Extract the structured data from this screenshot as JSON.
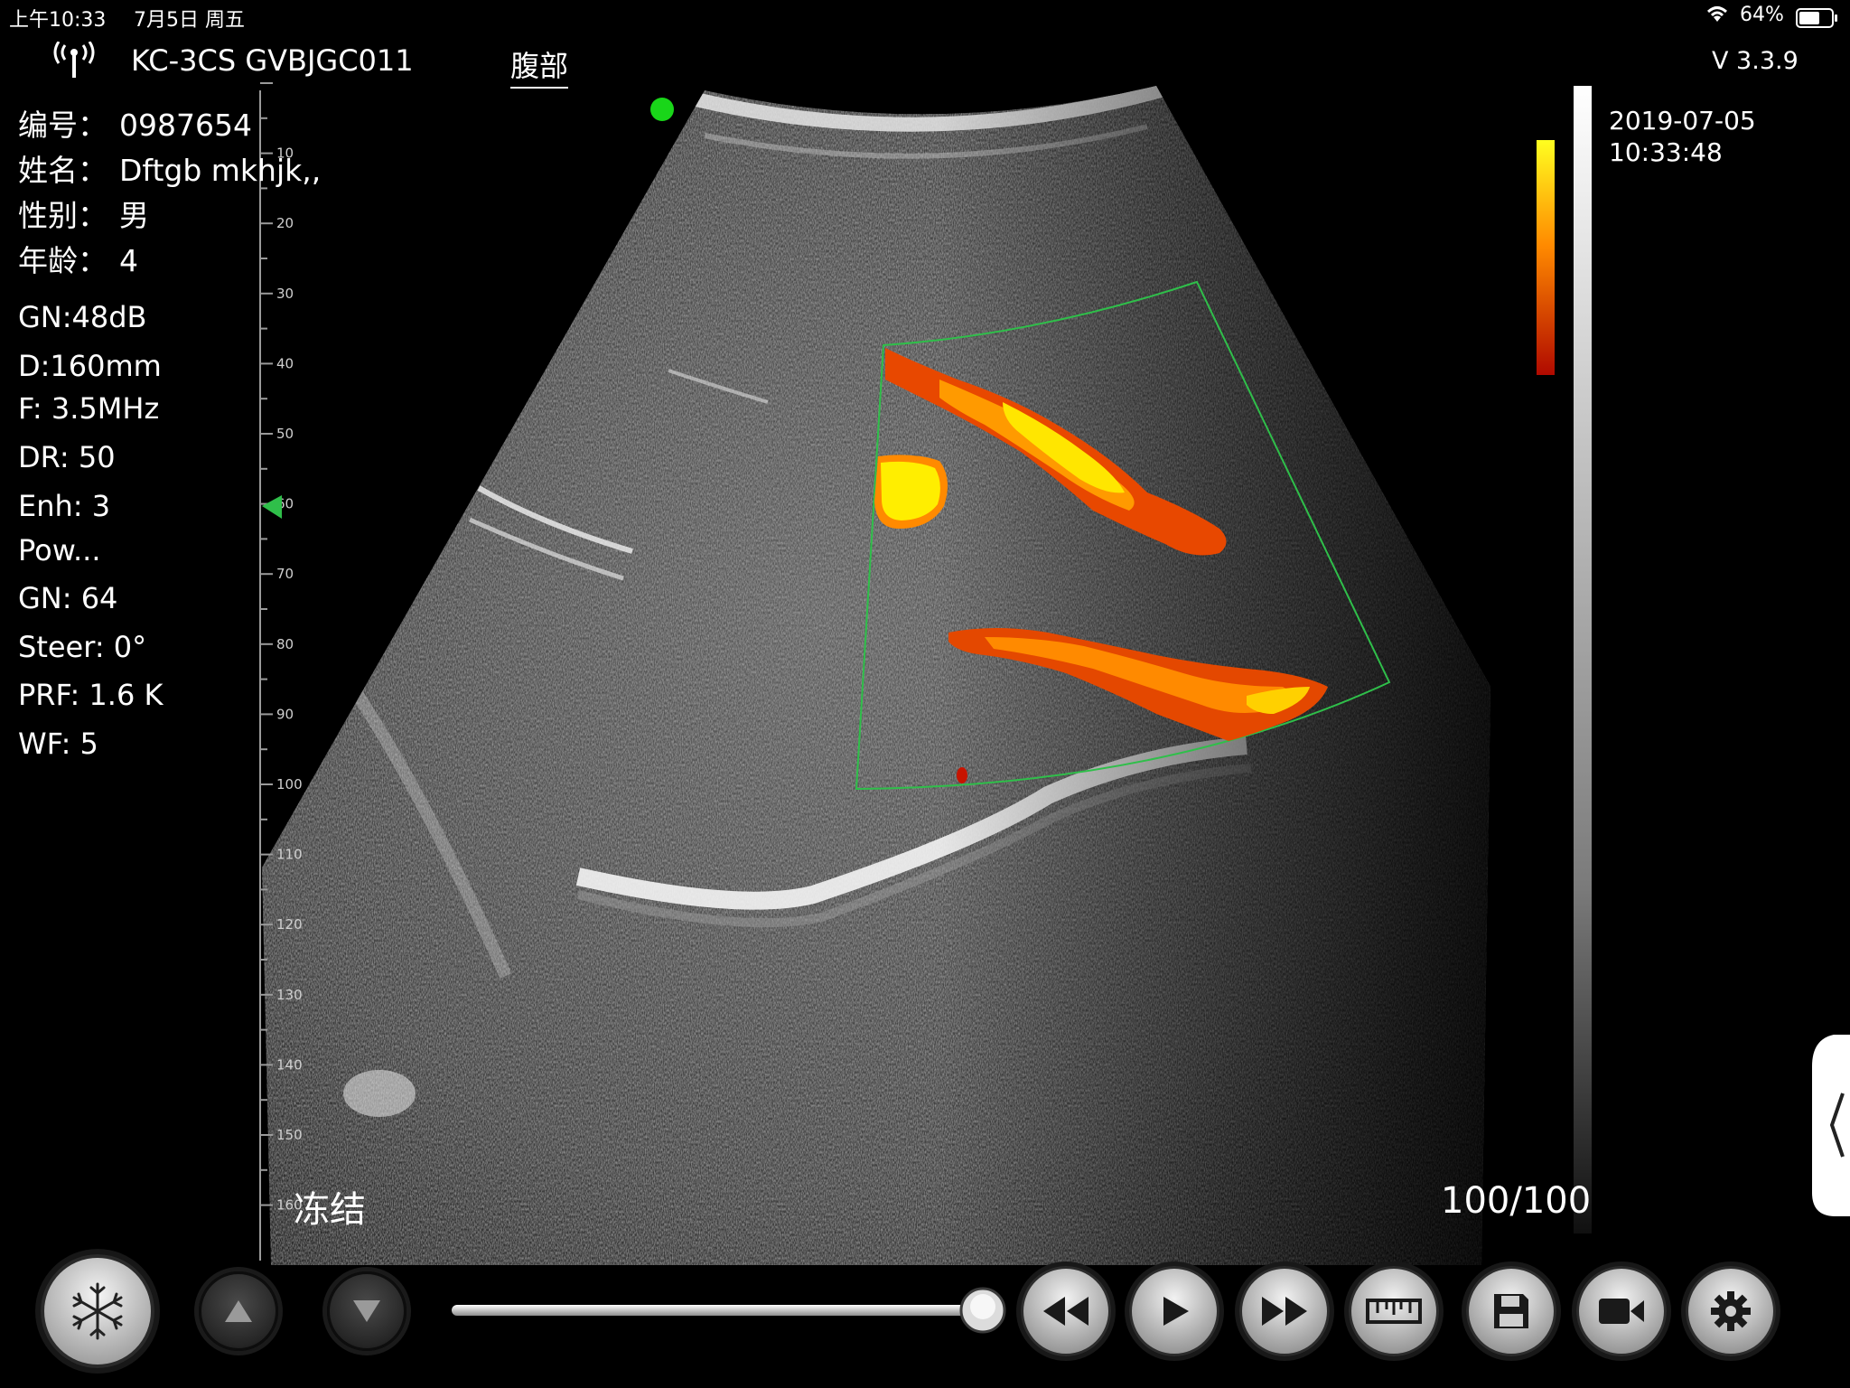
{
  "status_bar": {
    "time": "上午10:33",
    "date": "7月5日 周五",
    "battery": "64%",
    "battery_level": 0.64,
    "icons": [
      "wifi-icon",
      "battery-icon"
    ]
  },
  "header": {
    "device_name": "KC-3CS GVBJGC011",
    "preset_tab": "腹部",
    "version": "V 3.3.9",
    "icons": [
      "signal-antenna-icon"
    ]
  },
  "patient": {
    "id_label": "编号：",
    "id_value": "0987654",
    "name_label": "姓名：",
    "name_value": "Dftgb mkhjk,,",
    "sex_label": "性别：",
    "sex_value": "男",
    "age_label": "年龄：",
    "age_value": "4"
  },
  "params": {
    "gain": "GN:48dB",
    "depth": "D:160mm",
    "freq": "F: 3.5MHz",
    "dr": "DR: 50",
    "enh": "Enh: 3",
    "mode": "Pow...",
    "color_gain": "GN: 64",
    "steer": "Steer: 0°",
    "prf": "PRF: 1.6 K",
    "wf": "WF: 5"
  },
  "ruler": {
    "labels": [
      "10",
      "20",
      "30",
      "40",
      "50",
      "60",
      "70",
      "80",
      "90",
      "100",
      "110",
      "120",
      "130",
      "140",
      "150",
      "160"
    ],
    "focus_at": "60"
  },
  "datetime": {
    "date": "2019-07-05",
    "time": "10:33:48"
  },
  "overlay": {
    "freeze_label": "冻结",
    "frame_counter": "100/100",
    "cine_position": 1.0
  },
  "colors": {
    "background": "#000000",
    "accent_green": "#19d619",
    "roi_green": "#2fbf4a",
    "doppler_hot": "#ffee00",
    "doppler_mid": "#ff7a00",
    "doppler_low": "#b81000"
  },
  "toolbar": {
    "buttons": [
      {
        "name": "freeze-button",
        "icon": "snowflake-icon"
      },
      {
        "name": "prev-image-button",
        "icon": "triangle-up-icon"
      },
      {
        "name": "next-image-button",
        "icon": "triangle-down-icon"
      },
      {
        "name": "rewind-button",
        "icon": "rewind-icon"
      },
      {
        "name": "play-button",
        "icon": "play-icon"
      },
      {
        "name": "fast-forward-button",
        "icon": "fast-forward-icon"
      },
      {
        "name": "measure-button",
        "icon": "ruler-icon"
      },
      {
        "name": "save-button",
        "icon": "floppy-disk-icon"
      },
      {
        "name": "record-button",
        "icon": "video-camera-icon"
      },
      {
        "name": "settings-button",
        "icon": "gear-icon"
      }
    ]
  }
}
